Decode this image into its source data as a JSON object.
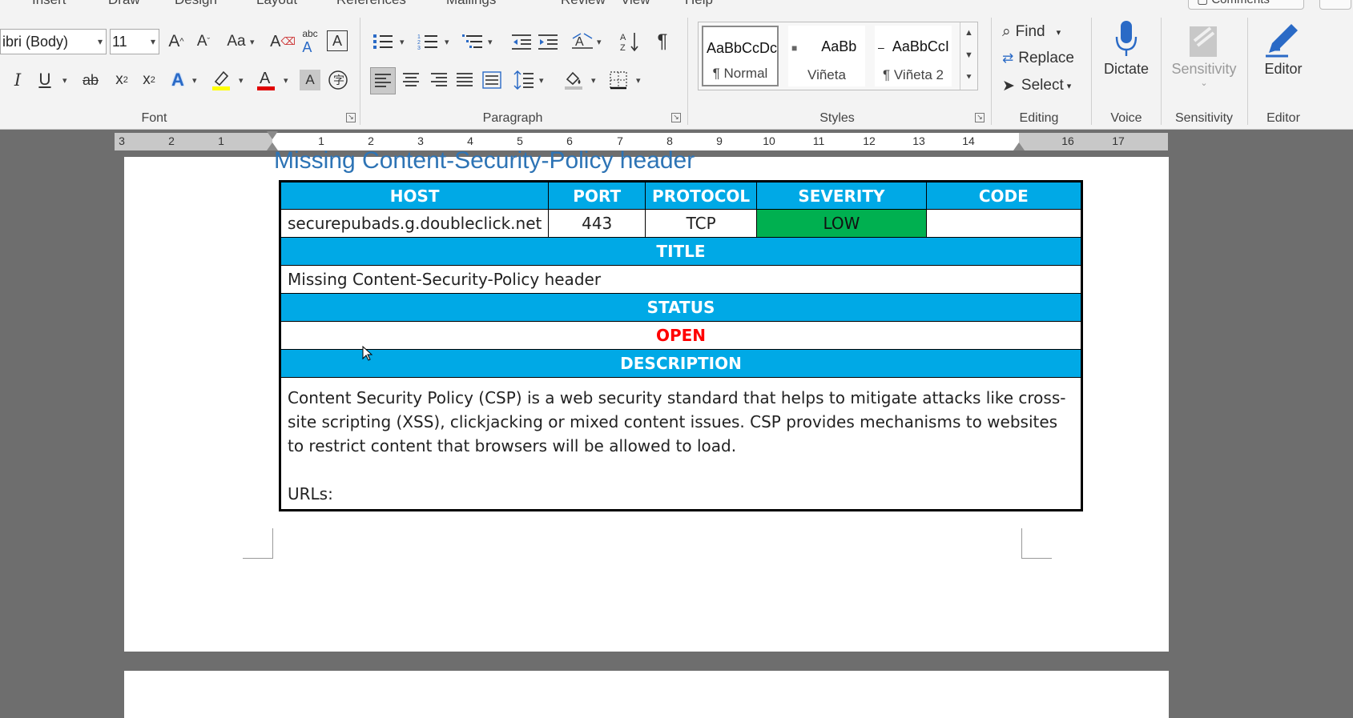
{
  "ribbon": {
    "tabs": [
      "Insert",
      "Draw",
      "Design",
      "Layout",
      "References",
      "Mailings",
      "Review",
      "View",
      "Help"
    ],
    "comments_label": "Comments",
    "font": {
      "group_label": "Font",
      "font_name": "ibri (Body)",
      "font_size": "11"
    },
    "paragraph": {
      "group_label": "Paragraph"
    },
    "styles": {
      "group_label": "Styles",
      "items": [
        {
          "preview": "AaBbCcDc",
          "name": "¶ Normal"
        },
        {
          "preview": "AaBb",
          "name": "Viñeta"
        },
        {
          "preview": "AaBbCcI",
          "name": "¶ Viñeta 2"
        }
      ]
    },
    "editing": {
      "group_label": "Editing",
      "find": "Find",
      "replace": "Replace",
      "select": "Select"
    },
    "voice": {
      "group_label": "Voice",
      "dictate": "Dictate"
    },
    "sensitivity": {
      "group_label": "Sensitivity",
      "button": "Sensitivity"
    },
    "editor": {
      "group_label": "Editor",
      "button": "Editor"
    }
  },
  "ruler": {
    "ticks": [
      "3",
      "2",
      "1",
      "1",
      "2",
      "3",
      "4",
      "5",
      "6",
      "7",
      "8",
      "9",
      "10",
      "11",
      "12",
      "13",
      "14",
      "16",
      "17"
    ]
  },
  "document": {
    "heading": "Missing Content-Security-Policy header",
    "table": {
      "headers": [
        "HOST",
        "PORT",
        "PROTOCOL",
        "SEVERITY",
        "CODE"
      ],
      "row": {
        "host": "securepubads.g.doubleclick.net",
        "port": "443",
        "protocol": "TCP",
        "severity": "LOW",
        "code": ""
      },
      "title_header": "TITLE",
      "title_value": "Missing Content-Security-Policy header",
      "status_header": "STATUS",
      "status_value": "OPEN",
      "description_header": "DESCRIPTION",
      "description_text": "Content Security Policy (CSP) is a web security standard that helps to mitigate attacks like cross-site scripting (XSS), clickjacking or mixed content issues. CSP provides mechanisms to websites to restrict content that browsers will be allowed to load.",
      "urls_label": "URLs:"
    }
  },
  "colors": {
    "table_header_bg": "#00a9e6",
    "severity_low_bg": "#00b050",
    "status_open": "#ff0000",
    "heading": "#2e74b5"
  }
}
